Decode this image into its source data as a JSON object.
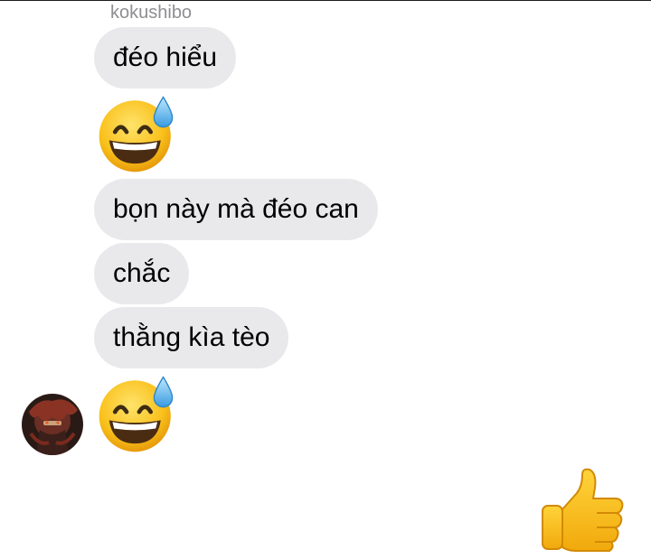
{
  "conversation": {
    "sender_name": "kokushibo",
    "messages": [
      {
        "type": "text",
        "text": "đéo hiểu"
      },
      {
        "type": "emoji",
        "emoji": "grinning-face-with-sweat-icon"
      },
      {
        "type": "text",
        "text": "bọn này mà đéo can"
      },
      {
        "type": "text",
        "text": "chắc"
      },
      {
        "type": "text",
        "text": "thằng kìa tèo"
      },
      {
        "type": "emoji",
        "emoji": "grinning-face-with-sweat-icon"
      }
    ],
    "reply": {
      "type": "emoji",
      "emoji": "thumbs-up-icon"
    }
  },
  "colors": {
    "incoming_bubble": "#e9e9eb",
    "sender_name": "#8e8e93",
    "emoji_yellow": "#f8c21a"
  }
}
